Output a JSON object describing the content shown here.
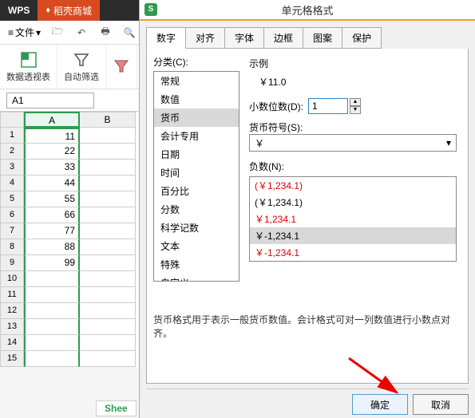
{
  "topbar": {
    "wps": "WPS",
    "docer": "稻壳商城"
  },
  "toolbar": {
    "file_menu": "文件",
    "name_box": "A1"
  },
  "ribbon": {
    "pivot": "数据透视表",
    "autofilter": "自动筛选"
  },
  "grid": {
    "cols": [
      "A",
      "B"
    ],
    "rows": [
      {
        "n": "1",
        "v": "11"
      },
      {
        "n": "2",
        "v": "22"
      },
      {
        "n": "3",
        "v": "33"
      },
      {
        "n": "4",
        "v": "44"
      },
      {
        "n": "5",
        "v": "55"
      },
      {
        "n": "6",
        "v": "66"
      },
      {
        "n": "7",
        "v": "77"
      },
      {
        "n": "8",
        "v": "88"
      },
      {
        "n": "9",
        "v": "99"
      },
      {
        "n": "10",
        "v": ""
      },
      {
        "n": "11",
        "v": ""
      },
      {
        "n": "12",
        "v": ""
      },
      {
        "n": "13",
        "v": ""
      },
      {
        "n": "14",
        "v": ""
      },
      {
        "n": "15",
        "v": ""
      }
    ]
  },
  "sheet_tab": "Shee",
  "dialog": {
    "title": "单元格格式",
    "tabs": [
      "数字",
      "对齐",
      "字体",
      "边框",
      "图案",
      "保护"
    ],
    "active_tab": 0,
    "category_label": "分类(C):",
    "categories": [
      "常规",
      "数值",
      "货币",
      "会计专用",
      "日期",
      "时间",
      "百分比",
      "分数",
      "科学记数",
      "文本",
      "特殊",
      "自定义"
    ],
    "selected_category": 2,
    "example_label": "示例",
    "example_value": "￥11.0",
    "decimals_label": "小数位数(D):",
    "decimals_value": "1",
    "symbol_label": "货币符号(S):",
    "symbol_value": "￥",
    "negative_label": "负数(N):",
    "negatives": [
      {
        "text": "(￥1,234.1)",
        "red": true
      },
      {
        "text": "(￥1,234.1)",
        "red": false
      },
      {
        "text": "￥1,234.1",
        "red": true
      },
      {
        "text": "￥-1,234.1",
        "red": false,
        "sel": true
      },
      {
        "text": "￥-1,234.1",
        "red": true
      }
    ],
    "description": "货币格式用于表示一般货币数值。会计格式可对一列数值进行小数点对齐。",
    "ok": "确定",
    "cancel": "取消"
  }
}
